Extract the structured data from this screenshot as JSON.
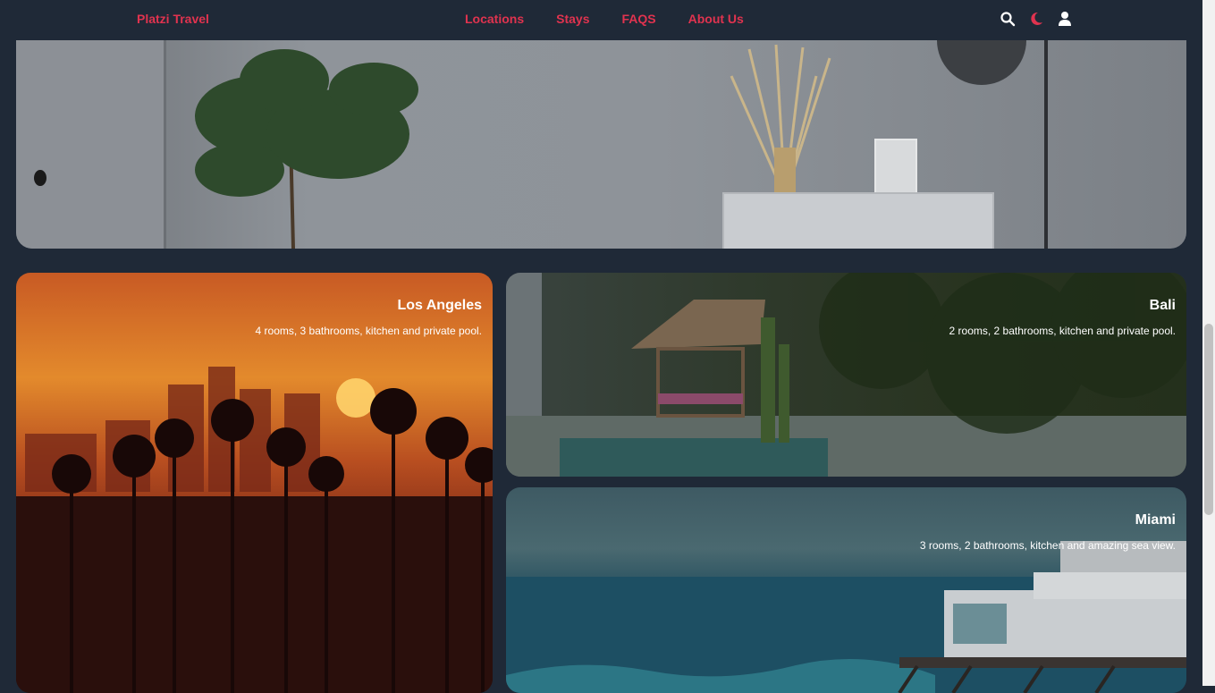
{
  "header": {
    "logo": "Platzi Travel",
    "nav": [
      "Locations",
      "Stays",
      "FAQS",
      "About Us"
    ],
    "icons": [
      "search-icon",
      "moon-icon",
      "user-icon"
    ],
    "accent_color": "#e0334f",
    "background_color": "#1f2937"
  },
  "cards": [
    {
      "title": "Los Angeles",
      "description": "4 rooms, 3 bathrooms, kitchen and private pool."
    },
    {
      "title": "Bali",
      "description": "2 rooms, 2 bathrooms, kitchen and private pool."
    },
    {
      "title": "Miami",
      "description": "3 rooms, 2 bathrooms, kitchen and amazing sea view."
    }
  ]
}
